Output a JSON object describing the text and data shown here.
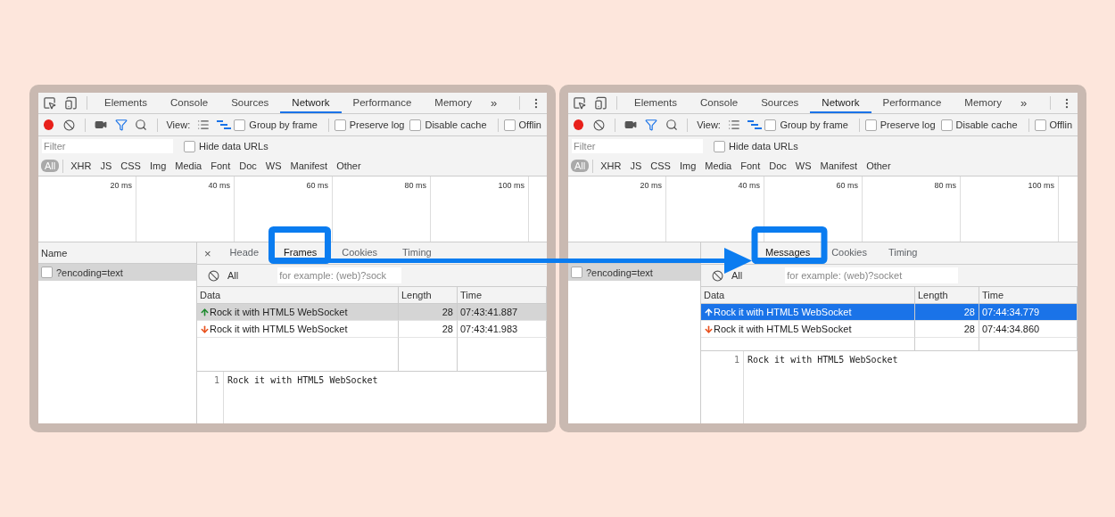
{
  "panels": [
    {
      "main_tabs": [
        {
          "label": "Elements",
          "selected": false
        },
        {
          "label": "Console",
          "selected": false
        },
        {
          "label": "Sources",
          "selected": false
        },
        {
          "label": "Network",
          "selected": true
        },
        {
          "label": "Performance",
          "selected": false
        },
        {
          "label": "Memory",
          "selected": false
        }
      ],
      "more_tabs": "»",
      "recording": true,
      "view_label": "View:",
      "toolbar_checkboxes": [
        {
          "label": "Group by frame",
          "checked": false
        },
        {
          "label": "Preserve log",
          "checked": false
        },
        {
          "label": "Disable cache",
          "checked": false
        },
        {
          "label": "Offlin",
          "checked": false
        }
      ],
      "filter": {
        "placeholder": "Filter"
      },
      "hide_data_urls": {
        "label": "Hide data URLs",
        "checked": false
      },
      "type_filters": [
        {
          "label": "All",
          "selected": true
        },
        {
          "label": "XHR",
          "selected": false
        },
        {
          "label": "JS",
          "selected": false
        },
        {
          "label": "CSS",
          "selected": false
        },
        {
          "label": "Img",
          "selected": false
        },
        {
          "label": "Media",
          "selected": false
        },
        {
          "label": "Font",
          "selected": false
        },
        {
          "label": "Doc",
          "selected": false
        },
        {
          "label": "WS",
          "selected": false
        },
        {
          "label": "Manifest",
          "selected": false
        },
        {
          "label": "Other",
          "selected": false
        }
      ],
      "timeline_ticks": [
        "20 ms",
        "40 ms",
        "60 ms",
        "80 ms",
        "100 ms"
      ],
      "requests": {
        "header": "Name",
        "items": [
          {
            "name": "?encoding=text",
            "selected": true
          }
        ]
      },
      "detail": {
        "close": "×",
        "tabs": [
          {
            "label": "Heade",
            "selected": false
          },
          {
            "label": "Frames",
            "selected": true
          },
          {
            "label": "Cookies",
            "selected": false
          },
          {
            "label": "Timing",
            "selected": false
          }
        ],
        "all_label": "All",
        "regex_placeholder": "for example: (web)?sock",
        "focused": false,
        "columns": [
          "Data",
          "Length",
          "Time"
        ],
        "rows": [
          {
            "kind": "sent",
            "data": "Rock it with HTML5 WebSocket",
            "length": "28",
            "time": "07:43:41.887",
            "selected": true
          },
          {
            "kind": "received",
            "data": "Rock it with HTML5 WebSocket",
            "length": "28",
            "time": "07:43:41.983",
            "selected": false
          }
        ],
        "viewer": {
          "line_number": "1",
          "text": "Rock it with HTML5 WebSocket"
        }
      }
    },
    {
      "main_tabs": [
        {
          "label": "Elements",
          "selected": false
        },
        {
          "label": "Console",
          "selected": false
        },
        {
          "label": "Sources",
          "selected": false
        },
        {
          "label": "Network",
          "selected": true
        },
        {
          "label": "Performance",
          "selected": false
        },
        {
          "label": "Memory",
          "selected": false
        }
      ],
      "more_tabs": "»",
      "recording": true,
      "view_label": "View:",
      "toolbar_checkboxes": [
        {
          "label": "Group by frame",
          "checked": false
        },
        {
          "label": "Preserve log",
          "checked": false
        },
        {
          "label": "Disable cache",
          "checked": false
        },
        {
          "label": "Offlin",
          "checked": false
        }
      ],
      "filter": {
        "placeholder": "Filter"
      },
      "hide_data_urls": {
        "label": "Hide data URLs",
        "checked": false
      },
      "type_filters": [
        {
          "label": "All",
          "selected": true
        },
        {
          "label": "XHR",
          "selected": false
        },
        {
          "label": "JS",
          "selected": false
        },
        {
          "label": "CSS",
          "selected": false
        },
        {
          "label": "Img",
          "selected": false
        },
        {
          "label": "Media",
          "selected": false
        },
        {
          "label": "Font",
          "selected": false
        },
        {
          "label": "Doc",
          "selected": false
        },
        {
          "label": "WS",
          "selected": false
        },
        {
          "label": "Manifest",
          "selected": false
        },
        {
          "label": "Other",
          "selected": false
        }
      ],
      "timeline_ticks": [
        "20 ms",
        "40 ms",
        "60 ms",
        "80 ms",
        "100 ms"
      ],
      "requests": {
        "items": [
          {
            "name": "?encoding=text",
            "selected": true
          }
        ]
      },
      "detail": {
        "tabs": [
          {
            "label": "Messages",
            "selected": true
          },
          {
            "label": "Cookies",
            "selected": false
          },
          {
            "label": "Timing",
            "selected": false
          }
        ],
        "all_label": "All",
        "regex_placeholder": "for example: (web)?socket",
        "focused": true,
        "columns": [
          "Data",
          "Length",
          "Time"
        ],
        "rows": [
          {
            "kind": "sent",
            "data": "Rock it with HTML5 WebSocket",
            "length": "28",
            "time": "07:44:34.779",
            "selected": true
          },
          {
            "kind": "received",
            "data": "Rock it with HTML5 WebSocket",
            "length": "28",
            "time": "07:44:34.860",
            "selected": false
          }
        ],
        "viewer": {
          "line_number": "1",
          "text": "Rock it with HTML5 WebSocket"
        }
      }
    }
  ],
  "annotation": {
    "highlights": true,
    "arrow": true
  }
}
